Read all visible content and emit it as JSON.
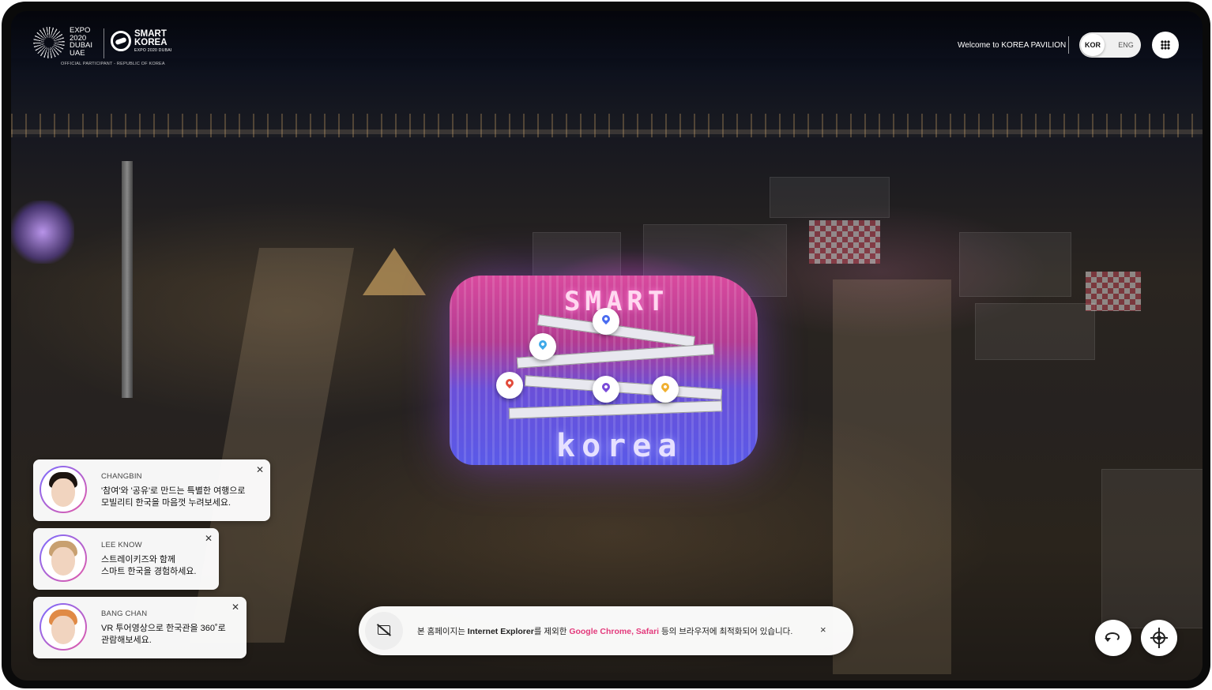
{
  "header": {
    "expo_logo_lines": [
      "EXPO",
      "2020",
      "DUBAI",
      "UAE"
    ],
    "smart_korea_lines": [
      "SMART",
      "KOREA"
    ],
    "smart_korea_sub": "EXPO 2020 DUBAI",
    "official": "OFFICIAL PARTICIPANT - REPUBLIC OF KOREA",
    "welcome": "Welcome to KOREA PAVILION",
    "lang_kor": "KOR",
    "lang_eng": "ENG",
    "menu_icon": "grid-icon"
  },
  "scene": {
    "pavilion_top_sign": "SMART",
    "pavilion_bottom_sign": "korea",
    "pins": [
      {
        "name": "pin-blue",
        "color": "#4a6cf0"
      },
      {
        "name": "pin-lightblue",
        "color": "#3fa9e8"
      },
      {
        "name": "pin-red",
        "color": "#e24b3b"
      },
      {
        "name": "pin-purple",
        "color": "#7a4ad8"
      },
      {
        "name": "pin-yellow",
        "color": "#f0b030"
      }
    ]
  },
  "chats": [
    {
      "name": "CHANGBIN",
      "line1": "'참여'와 '공유'로 만드는 특별한 여행으로",
      "line2": "모빌리티 한국을 마음껏 누려보세요.",
      "hair": "#1c1410"
    },
    {
      "name": "LEE KNOW",
      "line1": "스트레이키즈와 함께",
      "line2": "스마트 한국을 경험하세요.",
      "hair": "#c8a070"
    },
    {
      "name": "BANG CHAN",
      "line1": "VR 투어영상으로 한국관을 360˚로",
      "line2": "관람해보세요.",
      "hair": "#e08a45"
    }
  ],
  "notice": {
    "prefix": "본 홈페이지는 ",
    "ie": "Internet Explorer",
    "mid": "를 제외한 ",
    "browsers": "Google Chrome, Safari",
    "suffix": " 등의 브라우저에 최적화되어 있습니다.",
    "icon": "no-screen-icon",
    "close": "×"
  },
  "controls": {
    "rotate_icon": "rotate-icon",
    "location_icon": "locate-icon"
  },
  "colors": {
    "accent_pink": "#e33a7c",
    "avatar_ring_start": "#7a6cff",
    "avatar_ring_end": "#e35aa8"
  }
}
